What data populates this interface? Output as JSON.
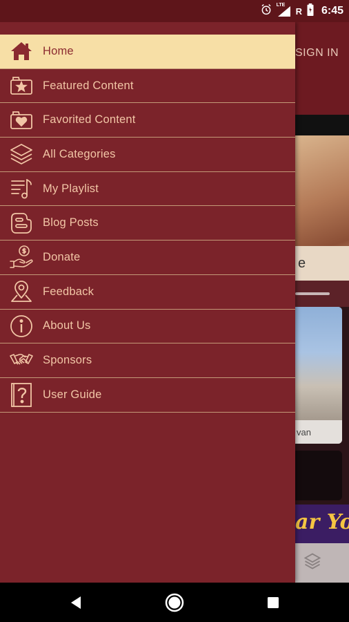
{
  "status_bar": {
    "time": "6:45",
    "network_label": "LTE",
    "roaming_label": "R"
  },
  "background_app": {
    "signin_label": "SIGN IN",
    "card1_caption": "e",
    "card2_caption": "van",
    "banner_text": "ar You"
  },
  "drawer": {
    "items": [
      {
        "label": "Home",
        "icon": "home-icon",
        "active": true
      },
      {
        "label": "Featured Content",
        "icon": "featured-content-icon",
        "active": false
      },
      {
        "label": "Favorited Content",
        "icon": "favorited-content-icon",
        "active": false
      },
      {
        "label": "All Categories",
        "icon": "layers-icon",
        "active": false
      },
      {
        "label": "My Playlist",
        "icon": "playlist-icon",
        "active": false
      },
      {
        "label": "Blog Posts",
        "icon": "blogger-icon",
        "active": false
      },
      {
        "label": "Donate",
        "icon": "donate-hand-icon",
        "active": false
      },
      {
        "label": "Feedback",
        "icon": "location-pin-icon",
        "active": false
      },
      {
        "label": "About Us",
        "icon": "info-icon",
        "active": false
      },
      {
        "label": "Sponsors",
        "icon": "handshake-icon",
        "active": false
      },
      {
        "label": "User Guide",
        "icon": "question-book-icon",
        "active": false
      }
    ]
  },
  "colors": {
    "drawer_bg": "#7b232a",
    "active_bg": "#f7dfa6",
    "label": "#f2c6a6",
    "divider": "#c49a78"
  }
}
